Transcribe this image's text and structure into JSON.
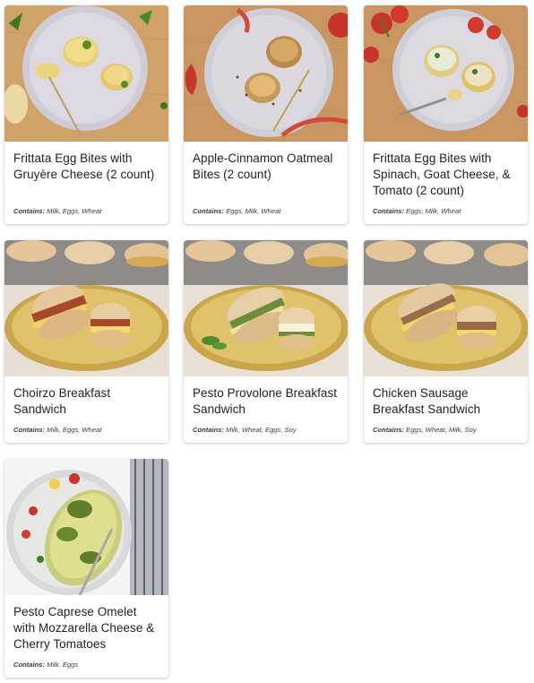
{
  "menu": {
    "allergen_prefix": "Contains:",
    "items": [
      {
        "title": "Frittata Egg Bites with Gruyère Cheese (2 count)",
        "allergens": "Milk, Eggs, Wheat",
        "image": "egg-bites-gruyere-photo"
      },
      {
        "title": "Apple-Cinnamon Oatmeal Bites (2 count)",
        "allergens": "Eggs, Milk, Wheat",
        "image": "oatmeal-bites-photo"
      },
      {
        "title": "Frittata Egg Bites with Spinach, Goat Cheese, & Tomato (2 count)",
        "allergens": "Eggs, Milk, Wheat",
        "image": "egg-bites-spinach-photo"
      },
      {
        "title": "Choirzo Breakfast Sandwich",
        "allergens": "Milk, Eggs, Wheat",
        "image": "chorizo-sandwich-photo"
      },
      {
        "title": "Pesto Provolone Breakfast Sandwich",
        "allergens": "Milk, Wheat, Eggs, Soy",
        "image": "pesto-sandwich-photo"
      },
      {
        "title": "Chicken Sausage Breakfast Sandwich",
        "allergens": "Eggs, Wheat, Milk, Soy",
        "image": "chicken-sausage-sandwich-photo"
      },
      {
        "title": "Pesto Caprese Omelet with Mozzarella Cheese & Cherry Tomatoes",
        "allergens": "Milk, Eggs",
        "image": "omelet-photo"
      }
    ]
  }
}
